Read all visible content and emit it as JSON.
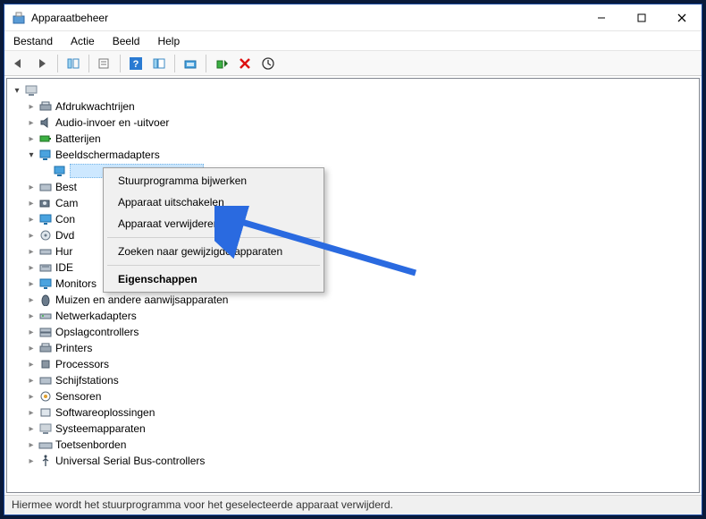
{
  "window": {
    "title": "Apparaatbeheer"
  },
  "menu": {
    "file": "Bestand",
    "action": "Actie",
    "view": "Beeld",
    "help": "Help"
  },
  "toolbar_tips": {
    "back": "Terug",
    "forward": "Vooruit",
    "show_hide": "Tonen/Verbergen",
    "properties": "Eigenschappen",
    "help": "Help",
    "export": "Exporteren",
    "scan": "Scannen naar hardwarewijzigingen",
    "enable": "Inschakelen",
    "uninstall": "Verwijderen",
    "update": "Stuurprogramma bijwerken"
  },
  "tree": {
    "root_hidden": "",
    "items": [
      {
        "label": "Afdrukwachtrijen"
      },
      {
        "label": "Audio-invoer en -uitvoer"
      },
      {
        "label": "Batterijen"
      },
      {
        "label": "Beeldschermadapters"
      },
      {
        "label": "Best"
      },
      {
        "label": "Cam"
      },
      {
        "label": "Con"
      },
      {
        "label": "Dvd"
      },
      {
        "label": "Hur"
      },
      {
        "label": "IDE"
      },
      {
        "label": "Monitors"
      },
      {
        "label": "Muizen en andere aanwijsapparaten"
      },
      {
        "label": "Netwerkadapters"
      },
      {
        "label": "Opslagcontrollers"
      },
      {
        "label": "Printers"
      },
      {
        "label": "Processors"
      },
      {
        "label": "Schijfstations"
      },
      {
        "label": "Sensoren"
      },
      {
        "label": "Softwareoplossingen"
      },
      {
        "label": "Systeemapparaten"
      },
      {
        "label": "Toetsenborden"
      },
      {
        "label": "Universal Serial Bus-controllers"
      }
    ]
  },
  "context_menu": {
    "update_driver": "Stuurprogramma bijwerken",
    "disable": "Apparaat uitschakelen",
    "uninstall": "Apparaat verwijderen",
    "scan": "Zoeken naar gewijzigde apparaten",
    "properties": "Eigenschappen"
  },
  "statusbar": {
    "text": "Hiermee wordt het stuurprogramma voor het geselecteerde apparaat verwijderd."
  }
}
